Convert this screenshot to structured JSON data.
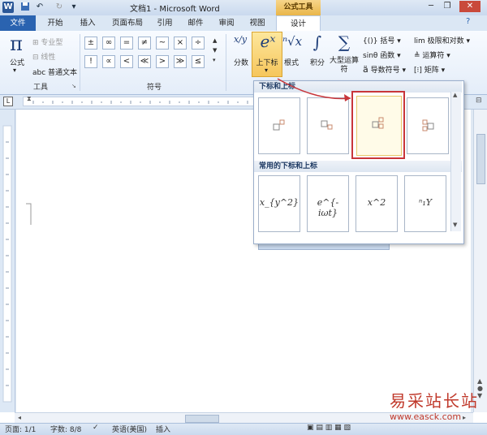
{
  "window": {
    "title": "文档1 - Microsoft Word",
    "context_tab_group": "公式工具",
    "app_icon": "W",
    "qat_icons": [
      "save-icon",
      "undo-icon",
      "redo-icon",
      "customize-icon"
    ],
    "controls": [
      "minimize-icon",
      "restore-icon",
      "close-icon"
    ]
  },
  "tabs": [
    "文件",
    "开始",
    "插入",
    "页面布局",
    "引用",
    "邮件",
    "审阅",
    "视图",
    "设计"
  ],
  "ribbon": {
    "tools_group": {
      "label": "工具",
      "equation": "公式",
      "professional": "专业型",
      "linear": "线性",
      "normal_text": "abc 普通文本"
    },
    "symbols_group": {
      "label": "符号",
      "row1": [
        "±",
        "∞",
        "=",
        "≠",
        "~",
        "×",
        "÷"
      ],
      "row2": [
        "!",
        "∝",
        "<",
        "≪",
        ">",
        "≫",
        "≤"
      ]
    },
    "structures": {
      "fraction": "分数",
      "script": "上下标",
      "radical": "根式",
      "integral": "积分",
      "large_operator": "大型运算符",
      "bracket": "括号",
      "function": "函数",
      "accent": "导数符号",
      "limit_log": "极限和对数",
      "operator": "运算符",
      "matrix": "矩阵"
    },
    "structure_icons": {
      "fraction": "x/y",
      "script": "eˣ",
      "radical": "ⁿ√x",
      "integral": "∫",
      "large_operator": "∑",
      "bracket": "{()}",
      "function": "sinθ",
      "accent": "ä"
    }
  },
  "gallery": {
    "section1": "下标和上标",
    "section2": "常用的下标和上标",
    "common": [
      "x_{y^2}",
      "e^{-iωt}",
      "x^2",
      "ⁿ₁Y"
    ]
  },
  "status": {
    "page": "页面: 1/1",
    "words": "字数: 8/8",
    "language": "英语(美国)",
    "mode": "插入"
  },
  "watermark": {
    "cn": "易采站长站",
    "url": "www.easck.com"
  },
  "colors": {
    "accent": "#2a63b0",
    "highlight": "#c8353a",
    "active_button": "#f6c65c"
  }
}
